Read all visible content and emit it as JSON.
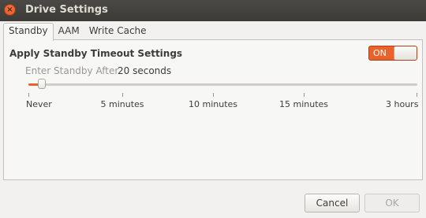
{
  "window": {
    "title": "Drive Settings",
    "close_glyph": "×"
  },
  "tabs": [
    {
      "label": "Standby",
      "active": true
    },
    {
      "label": "AAM",
      "active": false
    },
    {
      "label": "Write Cache",
      "active": false
    }
  ],
  "standby": {
    "heading": "Apply Standby Timeout Settings",
    "switch": {
      "label": "ON",
      "state": "on",
      "accent": "#e9622a"
    },
    "label": "Enter Standby After",
    "value_text": "20 seconds",
    "slider": {
      "value_fraction": 0.03,
      "marks": [
        "Never",
        "5 minutes",
        "10 minutes",
        "15 minutes",
        "3 hours"
      ]
    }
  },
  "buttons": {
    "cancel": "Cancel",
    "ok": "OK"
  }
}
